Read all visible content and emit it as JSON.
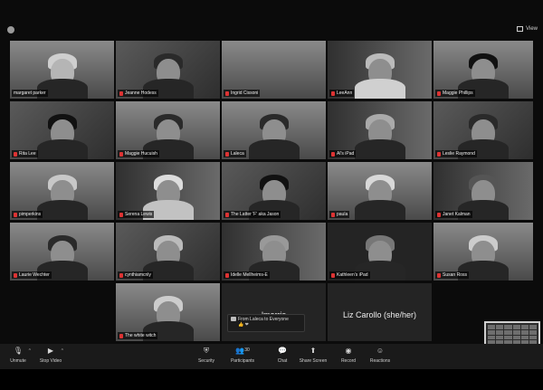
{
  "header": {
    "view_label": "View"
  },
  "tiles": {
    "r1": [
      "margaret parker",
      "Jeanne Hodess",
      "Ingrid Cissoni",
      "LeeAnn",
      "Maggie Phillips"
    ],
    "r2": [
      "Rita Lee",
      "Maggie Hucuish",
      "Laleca",
      "Al's iPad",
      "Leslie Raymond"
    ],
    "r3": [
      "pimperkins",
      "Serena Lewis",
      "The Latter 'F' aka Jason",
      "paula",
      "Janet Kalman"
    ],
    "r4": [
      "Laurie Wechter",
      "cynthiamcnly",
      "Idelle Mellheims-E",
      "Kathleen's iPad",
      "Susan Ross"
    ],
    "r5": [
      "The white witch",
      "lmorris",
      "Liz Carollo (she/her)"
    ]
  },
  "chat": {
    "from_text": "From Laleca to Everyone",
    "reactions": "👍 ❤"
  },
  "toolbar": {
    "unmute": "Unmute",
    "stop_video": "Stop Video",
    "security": "Security",
    "participants": "Participants",
    "participants_count": "30",
    "chat": "Chat",
    "share_screen": "Share Screen",
    "record": "Record",
    "reactions": "Reactions"
  }
}
